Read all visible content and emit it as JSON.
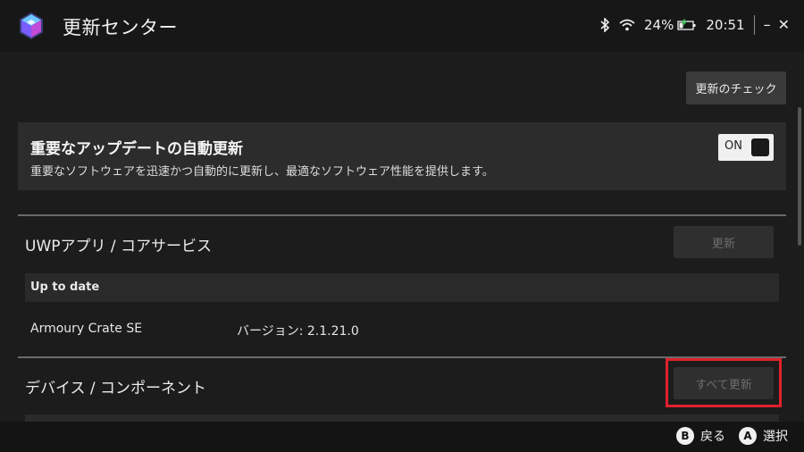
{
  "window": {
    "title": "更新センター",
    "battery_percent": "24%",
    "time": "20:51",
    "minimize_glyph": "–",
    "close_glyph": "✕"
  },
  "toolbar": {
    "check_updates_label": "更新のチェック"
  },
  "auto_update": {
    "title": "重要なアップデートの自動更新",
    "description": "重要なソフトウェアを迅速かつ自動的に更新し、最適なソフトウェア性能を提供します。",
    "toggle_label": "ON",
    "toggle_state": "on"
  },
  "sections": [
    {
      "title": "UWPアプリ / コアサービス",
      "button_label": "更新",
      "button_enabled": false,
      "status": "Up to date",
      "apps": [
        {
          "name": "Armoury Crate SE",
          "version": "バージョン: 2.1.21.0"
        }
      ]
    },
    {
      "title": "デバイス / コンポーネント",
      "button_label": "すべて更新",
      "button_enabled": false
    }
  ],
  "footer": {
    "back": {
      "button": "B",
      "label": "戻る"
    },
    "select": {
      "button": "A",
      "label": "選択"
    }
  },
  "icons": {
    "logo": "armoury-crate-logo-icon",
    "bluetooth": "bluetooth-icon",
    "wifi": "wifi-icon",
    "battery": "battery-charging-icon"
  },
  "colors": {
    "background": "#1c1c1c",
    "card": "#2c2c2c",
    "highlight": "#e0212b",
    "toggle_on": "#f0f0f0"
  }
}
